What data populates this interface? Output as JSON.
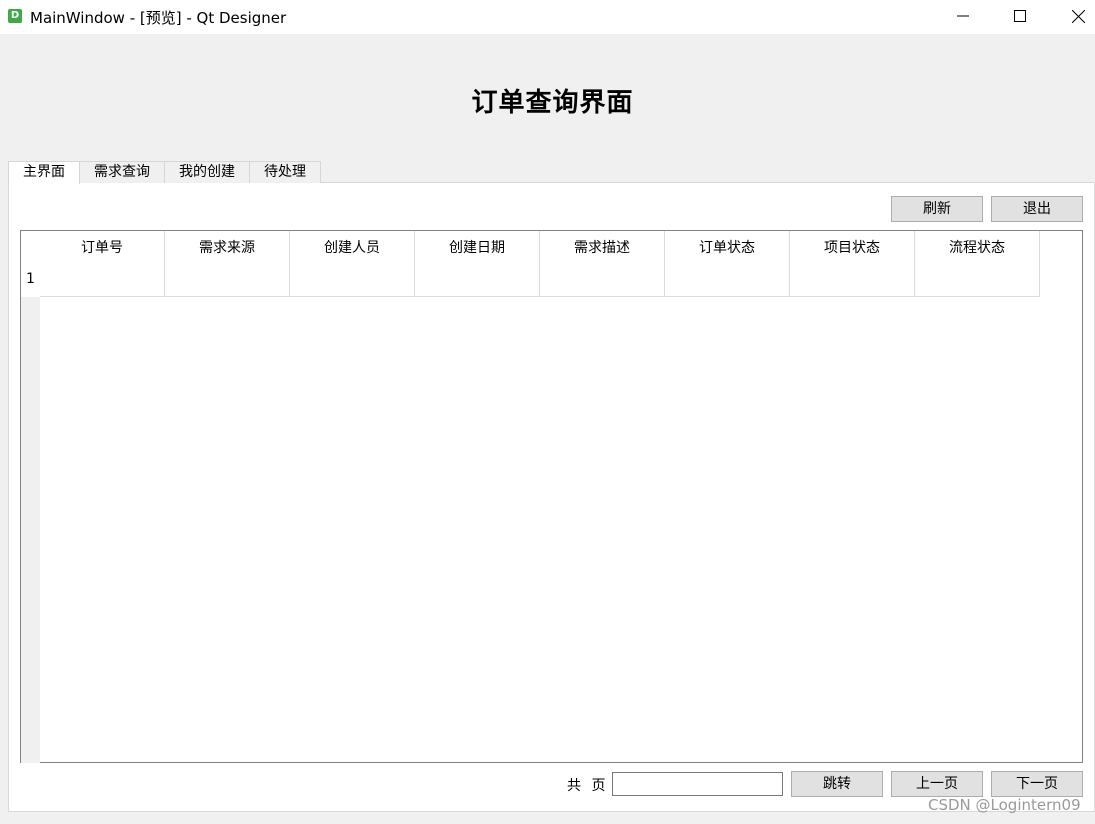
{
  "window": {
    "icon_letter": "D",
    "title": "MainWindow - [预览] - Qt Designer"
  },
  "header": {
    "title": "订单查询界面"
  },
  "tabs": [
    {
      "label": "主界面",
      "active": true
    },
    {
      "label": "需求查询",
      "active": false
    },
    {
      "label": "我的创建",
      "active": false
    },
    {
      "label": "待处理",
      "active": false
    }
  ],
  "toolbar": {
    "refresh_label": "刷新",
    "exit_label": "退出"
  },
  "table": {
    "columns": [
      "订单号",
      "需求来源",
      "创建人员",
      "创建日期",
      "需求描述",
      "订单状态",
      "项目状态",
      "流程状态"
    ],
    "row_numbers": [
      "1"
    ]
  },
  "pager": {
    "total_label": "共 页",
    "page_input_value": "",
    "jump_label": "跳转",
    "prev_label": "上一页",
    "next_label": "下一页"
  },
  "watermark": "CSDN @Logintern09",
  "colors": {
    "app_icon": "#41a84a",
    "panel_bg": "#f0f0f0",
    "button_bg": "#e1e1e1"
  }
}
